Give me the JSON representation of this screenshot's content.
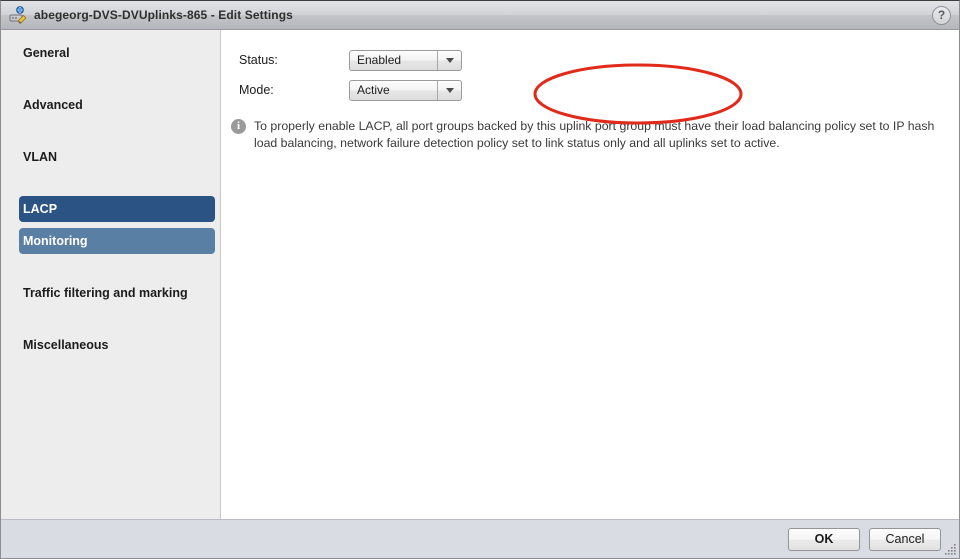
{
  "window": {
    "title": "abegeorg-DVS-DVUplinks-865 - Edit Settings",
    "title_icon": "dvs-edit-icon",
    "help_label": "?"
  },
  "sidebar": {
    "items": [
      {
        "label": "General",
        "state": "normal"
      },
      {
        "label": "Advanced",
        "state": "normal"
      },
      {
        "label": "VLAN",
        "state": "normal"
      },
      {
        "label": "LACP",
        "state": "selected"
      },
      {
        "label": "Monitoring",
        "state": "hovered"
      },
      {
        "label": "Traffic filtering and marking",
        "state": "normal"
      },
      {
        "label": "Miscellaneous",
        "state": "normal"
      }
    ]
  },
  "main": {
    "fields": [
      {
        "label": "Status:",
        "value": "Enabled"
      },
      {
        "label": "Mode:",
        "value": "Active"
      }
    ],
    "info": {
      "icon": "info-icon",
      "text": "To properly enable LACP, all port groups backed by this uplink port group must have their load balancing policy set to IP hash load balancing, network failure detection policy set to link status only and all uplinks set to active."
    }
  },
  "annotation": {
    "shape": "ellipse",
    "color": "#e02b1a"
  },
  "footer": {
    "ok_label": "OK",
    "cancel_label": "Cancel"
  },
  "colors": {
    "selected_nav": "#2b5383",
    "hovered_nav": "#5a7fa4",
    "sidebar_bg": "#ededed",
    "footer_bg": "#d9dce3",
    "annotation": "#e02b1a"
  }
}
